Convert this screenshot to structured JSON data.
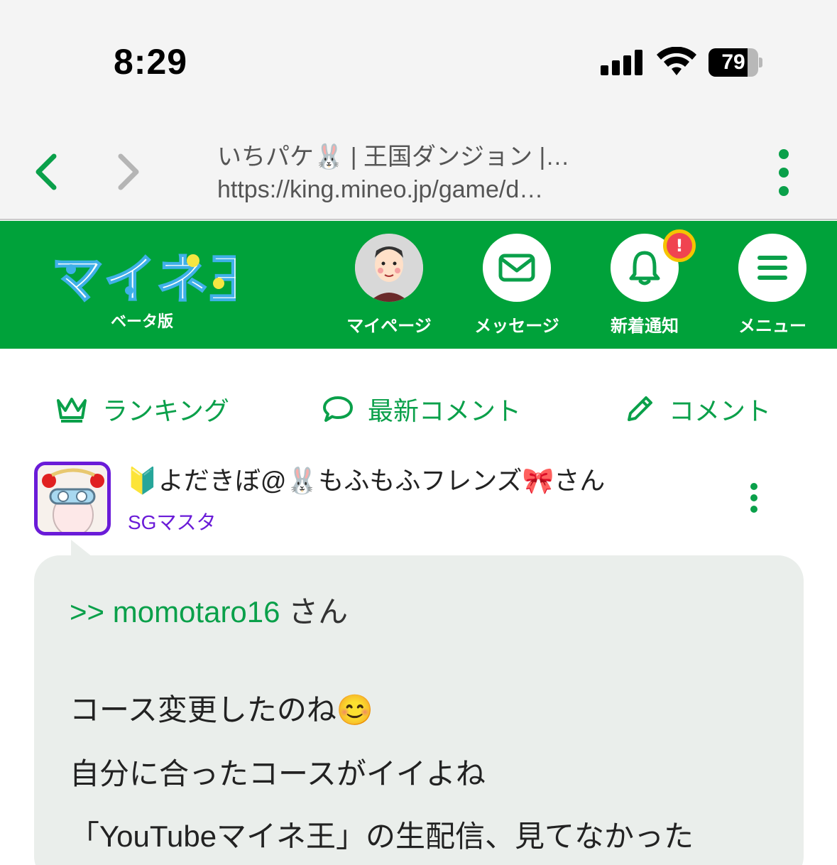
{
  "status_bar": {
    "time": "8:29",
    "battery": "79",
    "battery_level": 0.79
  },
  "browser": {
    "page_title": "いちパケ🐰 | 王国ダンジョン |…",
    "url": "https://king.mineo.jp/game/d…",
    "back_icon": "chevron-left-icon",
    "forward_icon": "chevron-right-icon",
    "more_icon": "vertical-dots-icon"
  },
  "header": {
    "logo_text": "マイネ王",
    "logo_sub": "ベータ版",
    "buttons": [
      {
        "label": "マイページ",
        "icon": "avatar-icon"
      },
      {
        "label": "メッセージ",
        "icon": "mail-icon"
      },
      {
        "label": "新着通知",
        "icon": "bell-icon",
        "badge": "!"
      },
      {
        "label": "メニュー",
        "icon": "hamburger-icon"
      }
    ],
    "colors": {
      "green": "#00a23a",
      "badge": "#f04450",
      "badge_ring": "#f5c400"
    }
  },
  "tabs": [
    {
      "label": "ランキング",
      "icon": "crown-icon"
    },
    {
      "label": "最新コメント",
      "icon": "speech-bubble-icon"
    },
    {
      "label": "コメント",
      "icon": "pencil-icon"
    }
  ],
  "comment": {
    "user_name": "🔰よだきぼ@🐰もふもふフレンズ🎀さん",
    "rank": "SGマスタ",
    "reply_to": ">> momotaro16",
    "reply_suffix": " さん",
    "lines": [
      "コース変更したのね😊",
      "自分に合ったコースがイイよね",
      "「YouTubeマイネ王」の生配信、見てなかった"
    ]
  }
}
